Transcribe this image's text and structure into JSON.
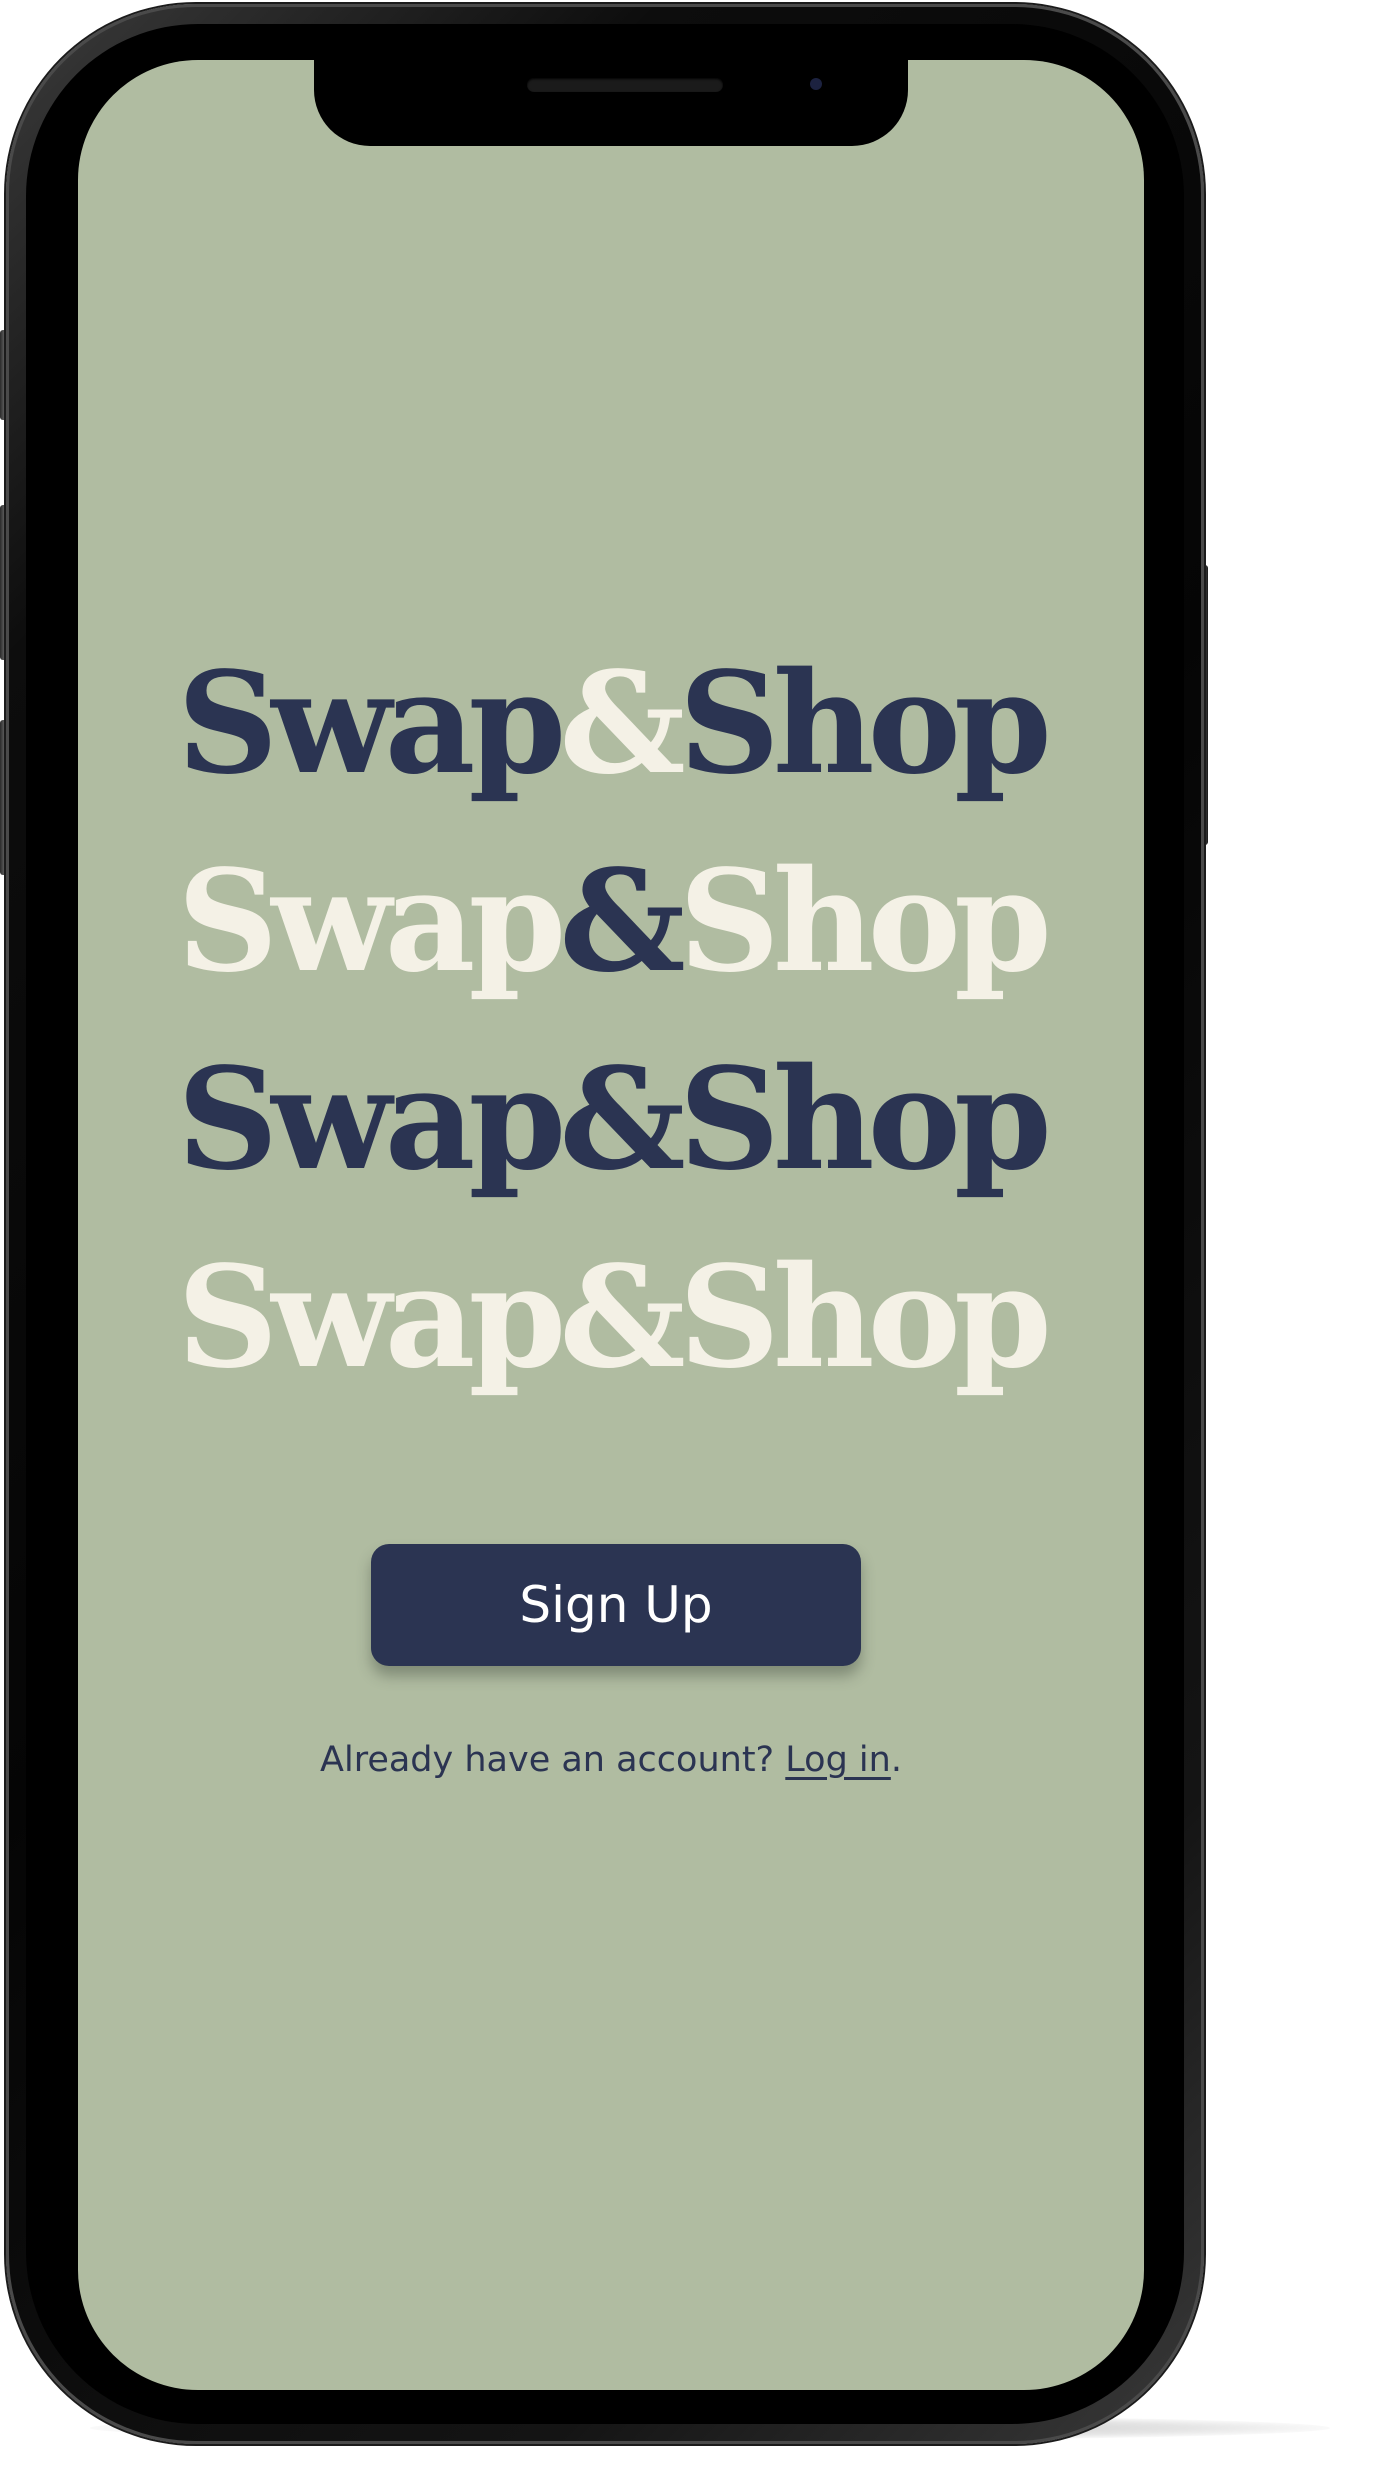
{
  "colors": {
    "screen_background": "#b0bca1",
    "navy": "#2b3452",
    "cream": "#f4f1e6"
  },
  "logo": {
    "lines": [
      {
        "word1": "Swap",
        "ampersand": "&",
        "word2": "Shop",
        "scheme": "navy-words-cream-ampersand"
      },
      {
        "word1": "Swap",
        "ampersand": "&",
        "word2": "Shop",
        "scheme": "cream-words-navy-ampersand"
      },
      {
        "word1": "Swap",
        "ampersand": "&",
        "word2": "Shop",
        "scheme": "all-navy"
      },
      {
        "word1": "Swap",
        "ampersand": "&",
        "word2": "Shop",
        "scheme": "all-cream"
      }
    ]
  },
  "signup": {
    "label": "Sign Up"
  },
  "login": {
    "prompt": "Already have an account?",
    "link_label": "Log in",
    "trailing": "."
  }
}
